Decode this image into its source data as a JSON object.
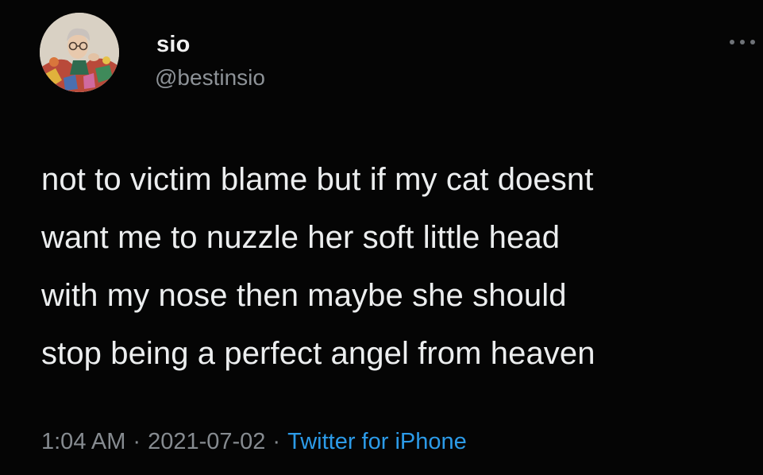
{
  "author": {
    "display_name": "sio",
    "handle": "@bestinsio"
  },
  "tweet": {
    "lines": [
      "not to victim blame but if my cat doesnt",
      "want me to nuzzle her soft little head",
      "with my nose then maybe she should",
      "stop being a perfect angel from heaven"
    ]
  },
  "meta": {
    "time": "1:04 AM",
    "date": "2021-07-02",
    "source": "Twitter for iPhone",
    "separator": "·"
  },
  "icons": {
    "more": "more-options-icon",
    "avatar": "avatar-image"
  },
  "colors": {
    "background": "#000000",
    "text": "#eceeef",
    "secondary": "#868b90",
    "link": "#2c9be8"
  }
}
